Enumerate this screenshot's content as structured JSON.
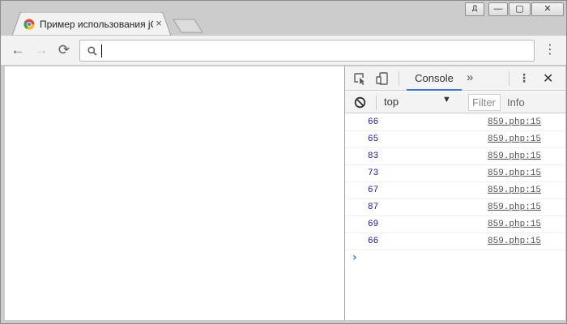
{
  "window": {
    "user_badge": "Д",
    "minimize_glyph": "—",
    "maximize_glyph": "▢",
    "close_glyph": "✕"
  },
  "tab": {
    "title": "Пример использования jQuery",
    "close_glyph": "×",
    "favicon": "chrome-favicon-icon"
  },
  "toolbar": {
    "back_glyph": "←",
    "forward_glyph": "→",
    "reload_glyph": "⟳",
    "menu_glyph": "⋮",
    "omnibox_value": "",
    "omnibox_icon": "search-icon"
  },
  "devtools": {
    "tabs": {
      "inspect_icon": "inspect-element-icon",
      "device_icon": "device-toolbar-icon",
      "console_label": "Console",
      "more_glyph": "»",
      "kebab_glyph": "⋮",
      "close_glyph": "✕"
    },
    "filterbar": {
      "clear_icon": "clear-console-icon",
      "context": "top",
      "context_arrow": "▼",
      "filter_placeholder": "Filter",
      "level": "Info"
    },
    "prompt_glyph": "›",
    "logs": [
      {
        "value": "66",
        "source": "859.php:15"
      },
      {
        "value": "65",
        "source": "859.php:15"
      },
      {
        "value": "83",
        "source": "859.php:15"
      },
      {
        "value": "73",
        "source": "859.php:15"
      },
      {
        "value": "67",
        "source": "859.php:15"
      },
      {
        "value": "87",
        "source": "859.php:15"
      },
      {
        "value": "69",
        "source": "859.php:15"
      },
      {
        "value": "66",
        "source": "859.php:15"
      }
    ]
  },
  "colors": {
    "frame": "#cccccc",
    "console_value": "#1a1aa6",
    "accent": "#3879d9"
  }
}
